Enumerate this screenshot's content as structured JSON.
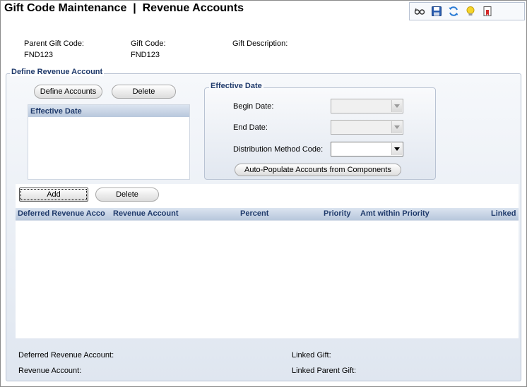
{
  "header": {
    "title": "Gift Code Maintenance  |  Revenue Accounts",
    "toolbar_icons": [
      "glasses-icon",
      "save-icon",
      "refresh-icon",
      "lightbulb-icon",
      "bookmark-icon"
    ]
  },
  "info": {
    "parent_gift_code_label": "Parent Gift Code:",
    "parent_gift_code_value": "FND123",
    "gift_code_label": "Gift Code:",
    "gift_code_value": "FND123",
    "gift_description_label": "Gift Description:"
  },
  "define_revenue": {
    "section_title": "Define Revenue Account",
    "define_accounts_button": "Define Accounts",
    "delete_button": "Delete",
    "effective_list_header": "Effective Date"
  },
  "effective_date": {
    "group_title": "Effective Date",
    "begin_date_label": "Begin Date:",
    "end_date_label": "End Date:",
    "distribution_method_label": "Distribution Method Code:",
    "auto_populate_button": "Auto-Populate Accounts from Components"
  },
  "accounts": {
    "add_button": "Add",
    "delete_button": "Delete",
    "columns": [
      "Deferred Revenue Acco",
      "Revenue Account",
      "Percent",
      "Priority",
      "Amt within Priority",
      "Linked"
    ]
  },
  "footer": {
    "deferred_revenue_label": "Deferred Revenue Account:",
    "revenue_account_label": "Revenue Account:",
    "linked_gift_label": "Linked Gift:",
    "linked_parent_gift_label": "Linked Parent Gift:"
  },
  "colors": {
    "accent_title": "#1f3a6b",
    "panel_border": "#b9c3d3",
    "header_gradient_top": "#dbe4f0",
    "header_gradient_bottom": "#b8c7dc"
  }
}
